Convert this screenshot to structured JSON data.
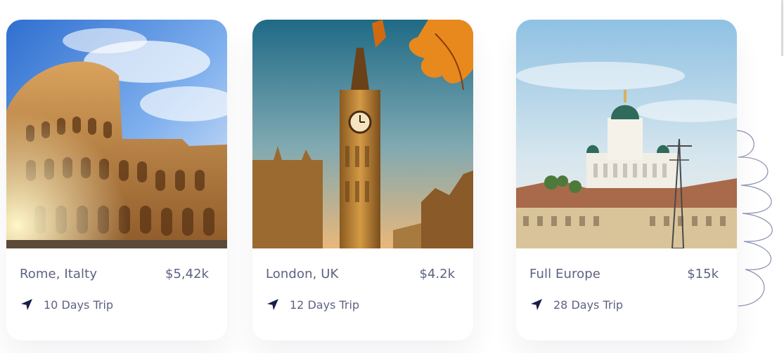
{
  "destinations": [
    {
      "name": "Rome, Italty",
      "price": "$5,42k",
      "duration": "10 Days Trip",
      "image": "colosseum-photo",
      "icon": "navigation-arrow-icon"
    },
    {
      "name": "London, UK",
      "price": "$4.2k",
      "duration": "12 Days Trip",
      "image": "big-ben-photo",
      "icon": "navigation-arrow-icon"
    },
    {
      "name": "Full Europe",
      "price": "$15k",
      "duration": "28 Days Trip",
      "image": "helsinki-cathedral-photo",
      "icon": "navigation-arrow-icon"
    }
  ],
  "colors": {
    "text": "#5e6282",
    "icon": "#181e4b",
    "card": "#ffffff",
    "decor_stroke": "#8a8fb0"
  }
}
